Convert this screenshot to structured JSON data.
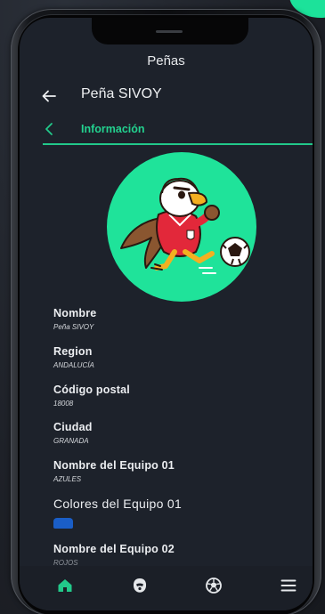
{
  "app": {
    "title": "Peñas"
  },
  "header": {
    "back_icon": "arrow-left-icon",
    "title": "Peña SIVOY"
  },
  "section": {
    "chevron_icon": "chevron-left-icon",
    "label": "Información",
    "accent_color": "#22c98a"
  },
  "logo": {
    "name": "eagle-mascot-logo",
    "background_color": "#1fe39a"
  },
  "fields": [
    {
      "label": "Nombre",
      "value": "Peña SIVOY"
    },
    {
      "label": "Region",
      "value": "ANDALUCÍA"
    },
    {
      "label": "Código postal",
      "value": "18008"
    },
    {
      "label": "Ciudad",
      "value": "GRANADA"
    },
    {
      "label": "Nombre del Equipo 01",
      "value": "AZULES"
    }
  ],
  "team01_colors": {
    "label": "Colores del Equipo 01",
    "color": "#1a5ec7"
  },
  "team02": {
    "label": "Nombre del Equipo 02",
    "value": "ROJOS"
  },
  "bottom_nav": [
    {
      "icon": "home-icon",
      "active": true,
      "color": "#22c98a"
    },
    {
      "icon": "player-icon",
      "active": false,
      "color": "#e6e8eb"
    },
    {
      "icon": "ball-icon",
      "active": false,
      "color": "#e6e8eb"
    },
    {
      "icon": "menu-icon",
      "active": false,
      "color": "#e6e8eb"
    }
  ]
}
